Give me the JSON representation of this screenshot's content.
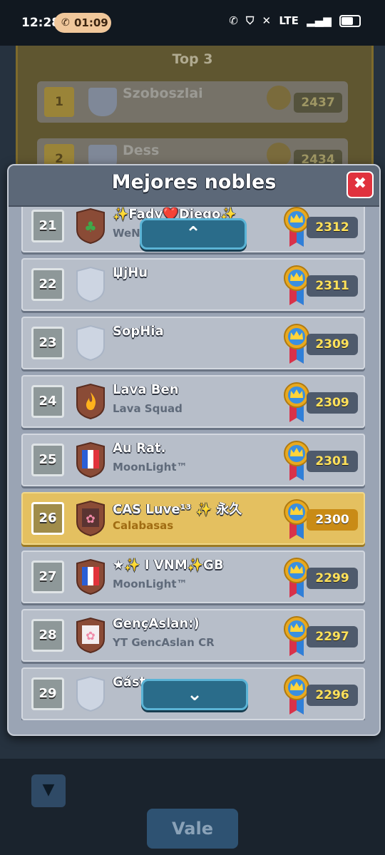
{
  "status_bar": {
    "time": "12:28",
    "call_time": "01:09",
    "network": "LTE"
  },
  "background": {
    "section_title": "Top 3",
    "rows": [
      {
        "rank": "1",
        "name": "Szoboszlai",
        "score": "2437"
      },
      {
        "rank": "2",
        "name": "Dess",
        "score": "2434"
      }
    ],
    "confirm_label": "Vale"
  },
  "dialog": {
    "title": "Mejores nobles",
    "close_label": "✖"
  },
  "scroll": {
    "up": "⌃",
    "down": "⌄"
  },
  "rows": [
    {
      "rank": "21",
      "name": "✨Fady❤️Diego✨",
      "clan": "WeN",
      "score": "2312",
      "badge": "clover"
    },
    {
      "rank": "22",
      "name": "ЏјHu",
      "clan": "",
      "score": "2311",
      "badge": "none"
    },
    {
      "rank": "23",
      "name": "SopHia",
      "clan": "",
      "score": "2309",
      "badge": "none"
    },
    {
      "rank": "24",
      "name": "Lava Ben",
      "clan": "Lava Squad",
      "score": "2309",
      "badge": "fire"
    },
    {
      "rank": "25",
      "name": "Au Rat.",
      "clan": "MoonLight™",
      "score": "2301",
      "badge": "france"
    },
    {
      "rank": "26",
      "name": "CAS Luve¹³ ✨ 永久",
      "clan": "Calabasas",
      "score": "2300",
      "badge": "flower",
      "highlight": true
    },
    {
      "rank": "27",
      "name": "★✨ I VNM✨GB",
      "clan": "MoonLight™",
      "score": "2299",
      "badge": "france"
    },
    {
      "rank": "28",
      "name": "GençAslan:)",
      "clan": "YT GencAslan CR",
      "score": "2297",
      "badge": "flower-light"
    },
    {
      "rank": "29",
      "name": "Gáston",
      "clan": "",
      "score": "2296",
      "badge": "none"
    }
  ],
  "colors": {
    "accent_yellow": "#e4c060",
    "score_text": "#ffe15a",
    "close_red": "#e0323e",
    "scroll_button": "#2a6c8a"
  }
}
